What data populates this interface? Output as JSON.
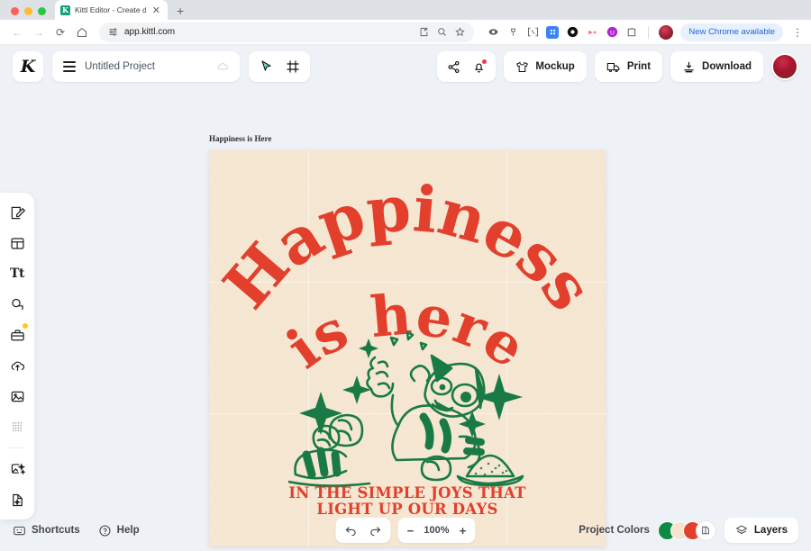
{
  "browser": {
    "tab": {
      "title": "Kittl Editor - Create designs t",
      "favicon_letter": "K",
      "close_label": "✕"
    },
    "new_tab_label": "+",
    "nav": {
      "back": "←",
      "forward": "→",
      "reload": "⟳",
      "home": "⌂"
    },
    "omnibox": {
      "url": "app.kittl.com",
      "site_settings_icon": "tune-icon"
    },
    "toolbar_icons": [
      "install-icon",
      "zoom-icon",
      "bookmark-star-icon",
      "extension-eye-icon",
      "extension-pin-icon",
      "extension-bracket-icon",
      "extension-blue-icon",
      "extension-target-icon",
      "extension-red-icon",
      "extension-purple-icon",
      "extension-puzzle-icon"
    ],
    "chrome_update": {
      "label": "New Chrome available"
    },
    "menu_label": "⋮"
  },
  "header": {
    "logo_letter": "K",
    "project_name": "Untitled Project",
    "menu_icon": "hamburger-icon",
    "cloud_icon": "cloud-sync-icon",
    "tools": [
      {
        "name": "select-tool",
        "icon": "cursor-icon"
      },
      {
        "name": "frame-tool",
        "icon": "frame-icon"
      }
    ],
    "share_icon": "share-icon",
    "notifications_icon": "bell-icon",
    "buttons": [
      {
        "label": "Mockup",
        "icon": "tshirt-icon"
      },
      {
        "label": "Print",
        "icon": "truck-icon"
      },
      {
        "label": "Download",
        "icon": "download-icon"
      }
    ],
    "avatar": "user-avatar"
  },
  "sidebar": {
    "items": [
      {
        "name": "sidebar-item-design",
        "icon": "pencil-square-icon",
        "badge": false
      },
      {
        "name": "sidebar-item-templates",
        "icon": "layout-icon",
        "badge": false
      },
      {
        "name": "sidebar-item-text",
        "icon": "text-icon",
        "label": "Tt",
        "badge": false
      },
      {
        "name": "sidebar-item-shapes",
        "icon": "shapes-icon",
        "badge": false
      },
      {
        "name": "sidebar-item-elements",
        "icon": "briefcase-icon",
        "badge": true
      },
      {
        "name": "sidebar-item-uploads",
        "icon": "cloud-upload-icon",
        "badge": false
      },
      {
        "name": "sidebar-item-photos",
        "icon": "image-icon",
        "badge": false
      },
      {
        "name": "sidebar-item-patterns",
        "icon": "dots-grid-icon",
        "badge": false
      },
      {
        "name": "sidebar-item-ai-image",
        "icon": "ai-image-icon",
        "badge": false
      },
      {
        "name": "sidebar-item-ai-vector",
        "icon": "ai-vector-icon",
        "badge": false
      }
    ]
  },
  "canvas": {
    "artboard_label": "Happiness is Here",
    "background_color": "#f7e8d3",
    "design": {
      "arch_text_line1": "Happiness",
      "arch_text_line2": "is here",
      "subtitle_line1": "IN THE SIMPLE JOYS THAT",
      "subtitle_line2": "LIGHT UP OUR DAYS",
      "illustration": "green-cat-line-art",
      "red_color": "#e23f2c",
      "green_color": "#1a7a45"
    }
  },
  "bottom": {
    "shortcuts_label": "Shortcuts",
    "shortcuts_icon": "keyboard-icon",
    "help_label": "Help",
    "help_icon": "question-circle-icon",
    "undo_icon": "undo-icon",
    "redo_icon": "redo-icon",
    "zoom_out_label": "−",
    "zoom_value": "100%",
    "zoom_in_label": "+",
    "project_colors_label": "Project Colors",
    "project_colors": [
      "#0e8a45",
      "#f5e4ce",
      "#e23f2c"
    ],
    "palette_icon": "palette-icon",
    "layers_label": "Layers",
    "layers_icon": "layers-icon"
  }
}
